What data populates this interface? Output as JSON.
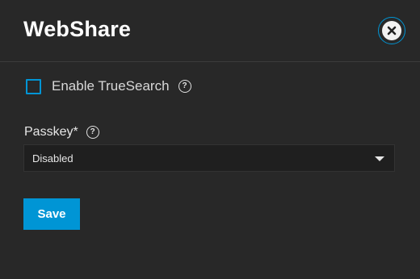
{
  "dialog": {
    "title": "WebShare",
    "close_icon": "close-circle-icon"
  },
  "truesearch": {
    "label": "Enable TrueSearch",
    "checked": false,
    "help_icon": "help-circle-icon",
    "help_glyph": "?"
  },
  "passkey": {
    "label": "Passkey",
    "required_mark": "*",
    "help_icon": "help-circle-icon",
    "help_glyph": "?",
    "selected_value": "Disabled",
    "dropdown_icon": "caret-down-icon"
  },
  "actions": {
    "save_label": "Save"
  },
  "colors": {
    "background": "#282828",
    "accent": "#0095d5",
    "field_background": "#1f1f1f"
  }
}
